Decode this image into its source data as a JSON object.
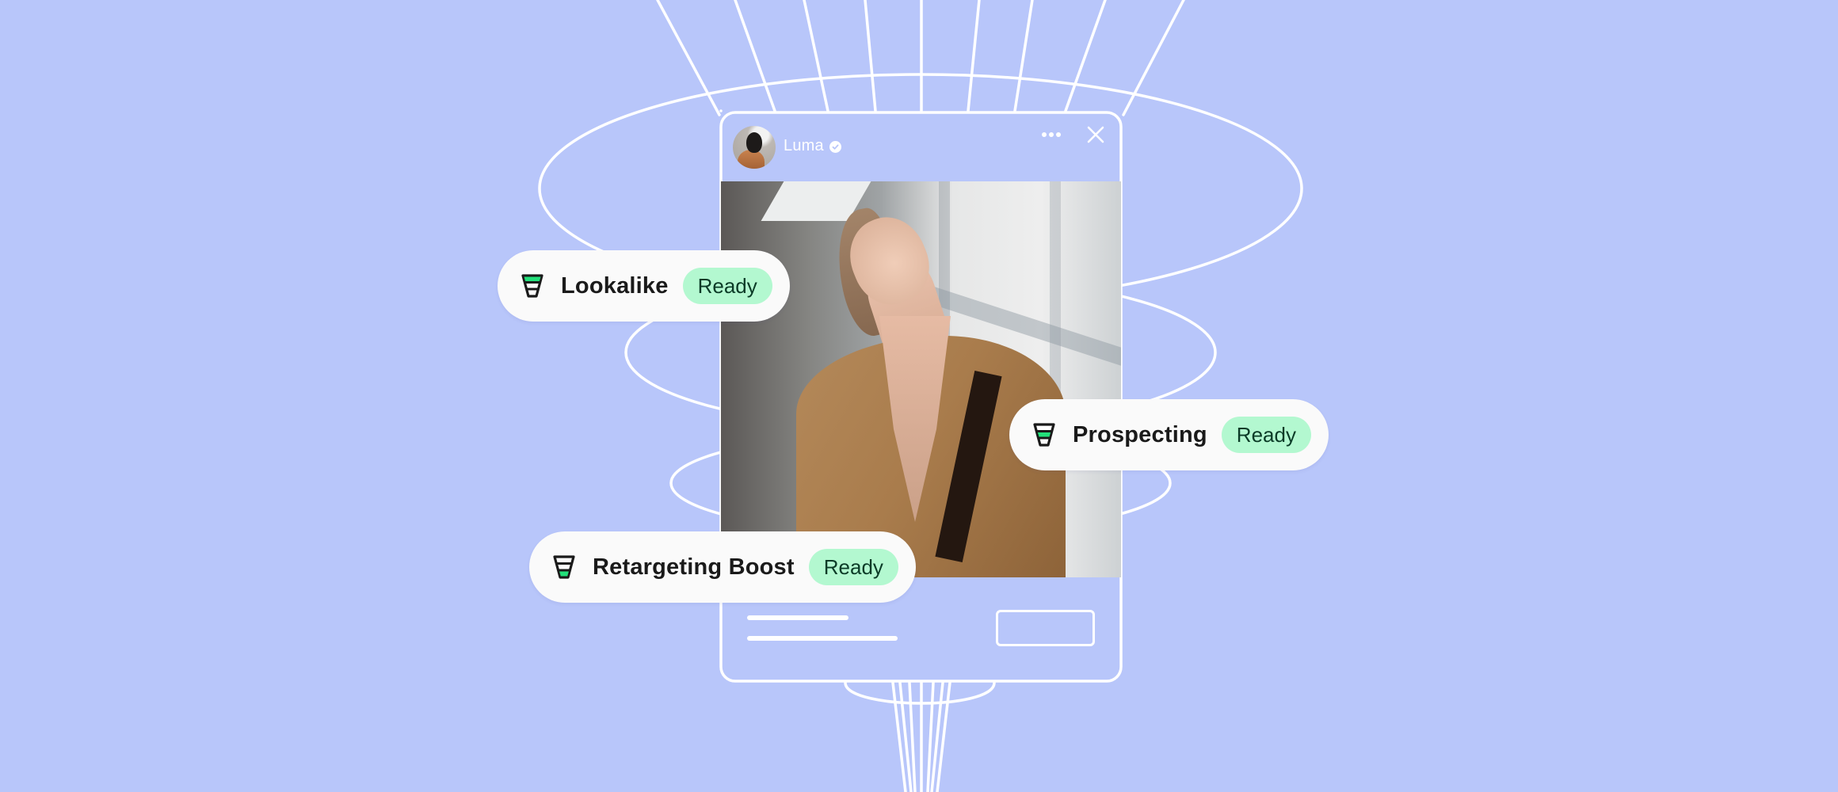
{
  "post_card": {
    "brand_name": "Luma",
    "verified": true,
    "more_icon": "ellipsis-horizontal-icon",
    "close_icon": "close-x-icon",
    "media": "fashion-photo-woman-camel-coat",
    "cta_placeholder": "",
    "text_lines": 2
  },
  "audiences": [
    {
      "label": "Lookalike",
      "status": "Ready",
      "funnel_stage": "top"
    },
    {
      "label": "Prospecting",
      "status": "Ready",
      "funnel_stage": "middle"
    },
    {
      "label": "Retargeting Boost",
      "status": "Ready",
      "funnel_stage": "bottom"
    }
  ],
  "colors": {
    "background": "#b8c6fa",
    "line_art": "#ffffff",
    "chip_background": "#fafafa",
    "badge_background": "#b3f8d0",
    "badge_text": "#0b3b27",
    "funnel_highlight": "#22e07a",
    "funnel_outline": "#1a1a1a"
  }
}
